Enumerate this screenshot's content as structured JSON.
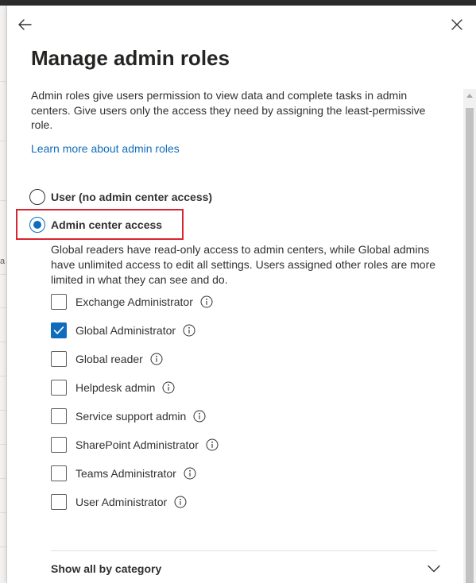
{
  "panel": {
    "title": "Manage admin roles",
    "description": "Admin roles give users permission to view data and complete tasks in admin centers. Give users only the access they need by assigning the least-permissive role.",
    "learn_more_link": "Learn more about admin roles"
  },
  "access_options": [
    {
      "label": "User (no admin center access)",
      "selected": false
    },
    {
      "label": "Admin center access",
      "selected": true
    }
  ],
  "admin_access_description": "Global readers have read-only access to admin centers, while Global admins have unlimited access to edit all settings. Users assigned other roles are more limited in what they can see and do.",
  "roles": [
    {
      "label": "Exchange Administrator",
      "checked": false
    },
    {
      "label": "Global Administrator",
      "checked": true
    },
    {
      "label": "Global reader",
      "checked": false
    },
    {
      "label": "Helpdesk admin",
      "checked": false
    },
    {
      "label": "Service support admin",
      "checked": false
    },
    {
      "label": "SharePoint Administrator",
      "checked": false
    },
    {
      "label": "Teams Administrator",
      "checked": false
    },
    {
      "label": "User Administrator",
      "checked": false
    }
  ],
  "category_toggle": {
    "label": "Show all by category"
  },
  "background_fragment": "a",
  "icons": {
    "back": "arrow-left-icon",
    "close": "close-icon",
    "info": "info-icon",
    "checkmark": "checkmark-icon",
    "expand": "chevron-down-icon"
  },
  "colors": {
    "accent": "#0f6cbd",
    "highlight_box": "#d9252f",
    "text": "#323130",
    "title": "#252423",
    "divider": "#e1dfdd"
  }
}
